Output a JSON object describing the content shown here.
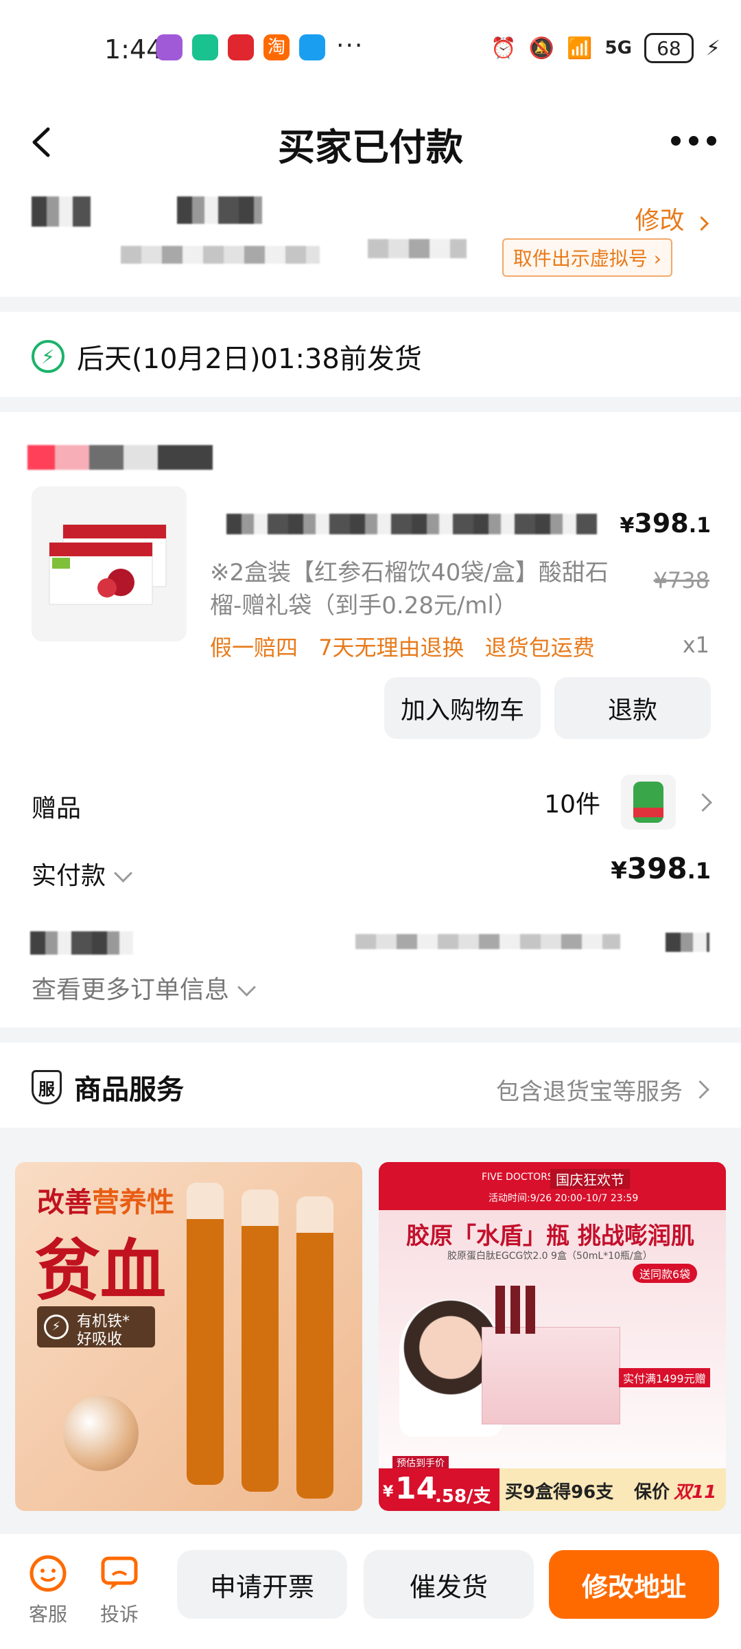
{
  "status_bar": {
    "time": "1:44",
    "more": "···",
    "network": "5G",
    "battery": "68",
    "app_icons": [
      {
        "name": "purple-app-icon",
        "color": "#a05ad8"
      },
      {
        "name": "green-chat-icon",
        "color": "#19c28f"
      },
      {
        "name": "red-bank-icon",
        "color": "#e0262e"
      },
      {
        "name": "taobao-icon",
        "color": "#ff6a00",
        "label": "淘"
      },
      {
        "name": "blue-app-icon",
        "color": "#1a9ff0"
      }
    ]
  },
  "header": {
    "title": "买家已付款"
  },
  "address": {
    "modify_label": "修改",
    "pickup_label": "取件出示虚拟号"
  },
  "shipping": {
    "text": "后天(10月2日)01:38前发货"
  },
  "product": {
    "price_symbol": "¥",
    "price_int": "398",
    "price_dec": ".1",
    "description": "※2盒装【红参石榴饮40袋/盒】酸甜石榴-赠礼袋（到手0.28元/ml）",
    "original_price": "¥738",
    "tags": [
      "假一赔四",
      "7天无理由退换",
      "退货包运费"
    ],
    "quantity": "x1",
    "add_cart_label": "加入购物车",
    "refund_label": "退款"
  },
  "gifts": {
    "label": "赠品",
    "count": "10件"
  },
  "payment": {
    "label": "实付款",
    "symbol": "¥",
    "int": "398",
    "dec": ".1"
  },
  "more_info": {
    "label": "查看更多订单信息"
  },
  "service": {
    "badge": "服",
    "title": "商品服务",
    "detail": "包含退货宝等服务"
  },
  "banner_left": {
    "line1_a": "改善",
    "line1_b": "营养性",
    "line2": "贫血",
    "badge_line1": "有机铁*",
    "badge_line2": "好吸收"
  },
  "banner_right": {
    "brand": "FIVE DOCTORS",
    "festival": "国庆狂欢节",
    "activity": "活动时间:9/26 20:00-10/7 23:59",
    "headline": "胶原「水盾」瓶 挑战嘭润肌",
    "subline": "胶原蛋白肽EGCG饮2.0 9盒（50mL*10瓶/盒）",
    "gift_tag": "送同款6袋",
    "promo": "实付满1499元赠",
    "price_tag": "预估到手价",
    "price_symbol": "¥",
    "price_big": "14",
    "price_small": ".58/支",
    "deal_a": "买9盒得96支",
    "deal_b": "保价",
    "deal_c": "双11"
  },
  "bottom_bar": {
    "service_label": "客服",
    "complain_label": "投诉",
    "invoice_label": "申请开票",
    "urge_label": "催发货",
    "modify_address_label": "修改地址",
    "accent": "#ff6a00"
  }
}
